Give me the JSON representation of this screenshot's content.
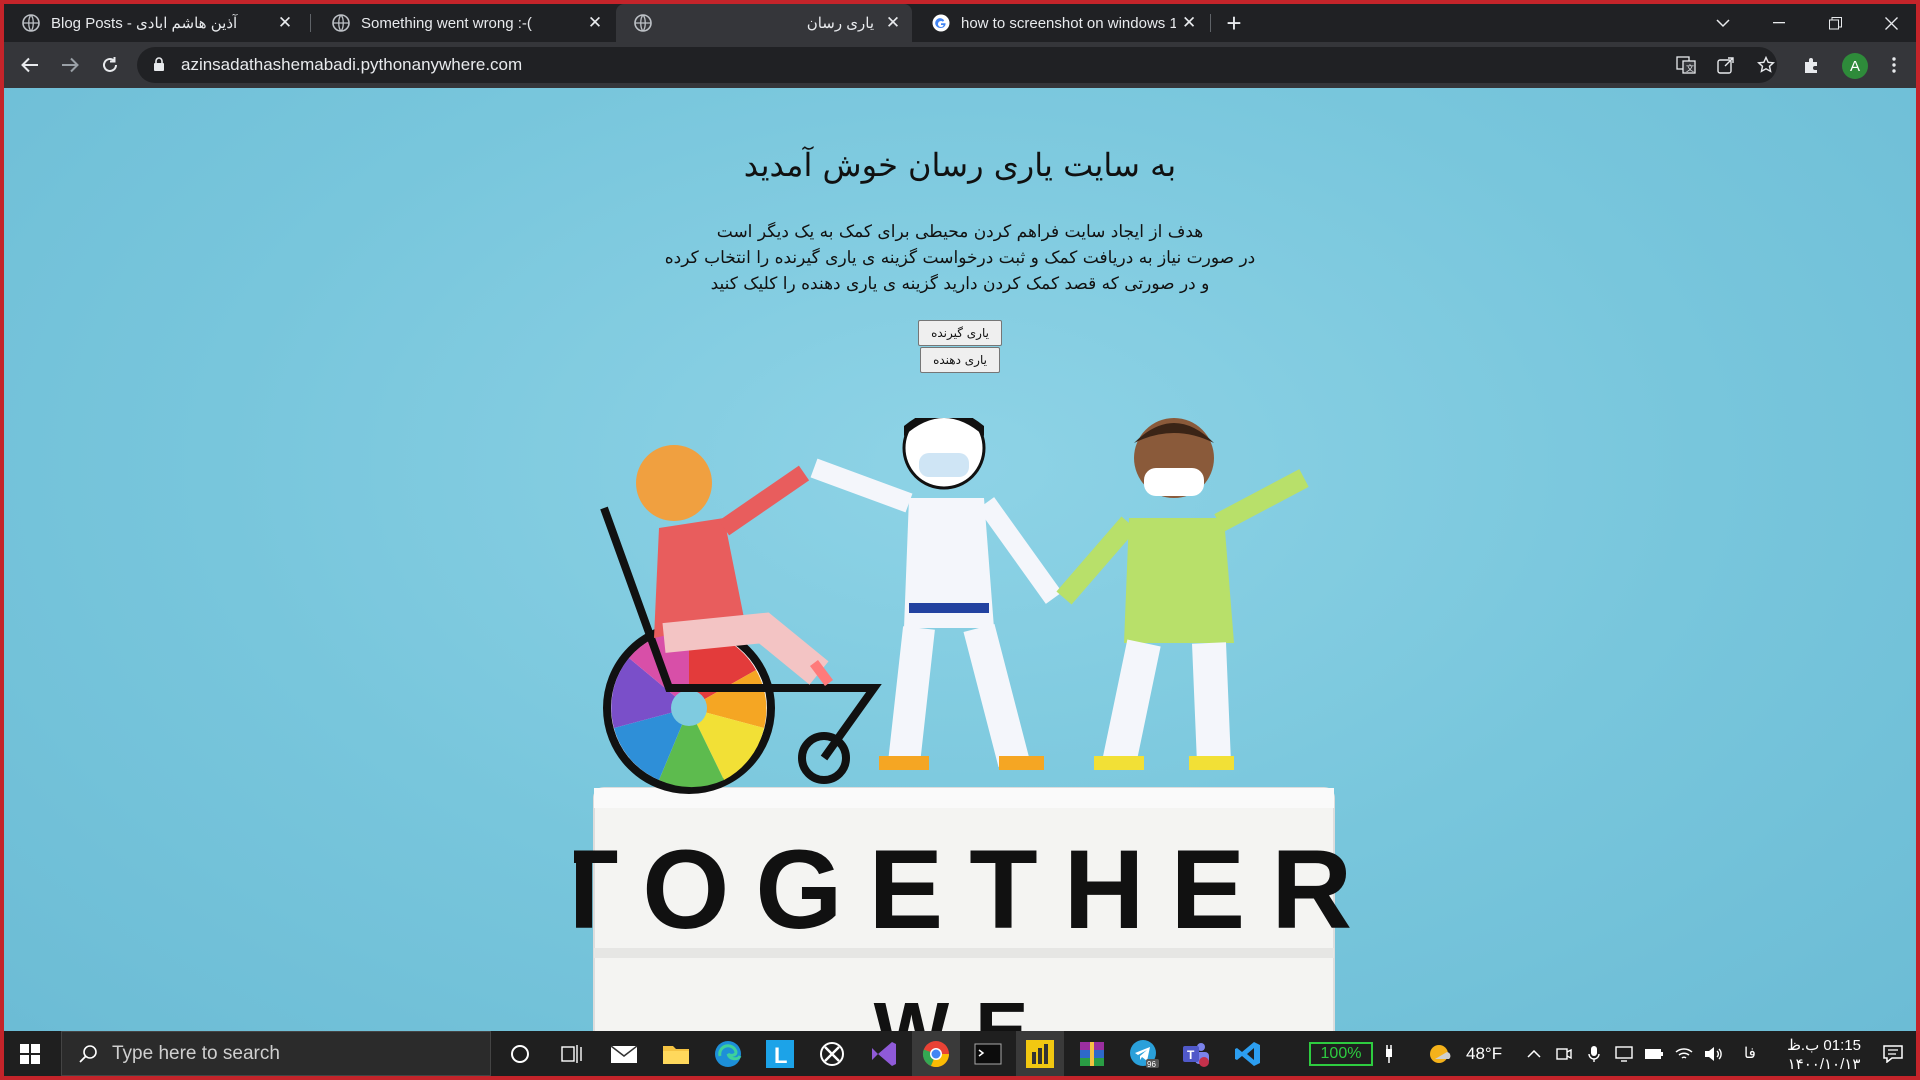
{
  "browser": {
    "tabs": [
      {
        "title": "Blog Posts - آذین هاشم ابادی",
        "active": false
      },
      {
        "title": "Something went wrong :-(",
        "active": false
      },
      {
        "title": "یاری رسان",
        "active": true
      },
      {
        "title": "how to screenshot on windows 1",
        "active": false
      }
    ],
    "url": "azinsadathashemabadi.pythonanywhere.com",
    "avatar_letter": "A"
  },
  "page": {
    "heading": "به سایت یاری رسان خوش آمدید",
    "lines": [
      "هدف از ایجاد سایت فراهم کردن محیطی برای کمک به یک دیگر است",
      "در صورت نیاز به دریافت کمک و ثبت درخواست گزینه ی یاری گیرنده را انتخاب کرده",
      "و در صورتی که قصد کمک کردن دارید گزینه ی یاری دهنده را کلیک کنید"
    ],
    "btn_receiver": "یاری گیرنده",
    "btn_giver": "یاری دهنده",
    "image_text": "TOGETHER",
    "image_text_2": "WE"
  },
  "taskbar": {
    "search_placeholder": "Type here to search",
    "battery": "100%",
    "weather": "48°F",
    "lang": "فا",
    "time": "01:15 ب.ظ",
    "date": "۱۴۰۰/۱۰/۱۳",
    "telegram_badge": "96"
  }
}
